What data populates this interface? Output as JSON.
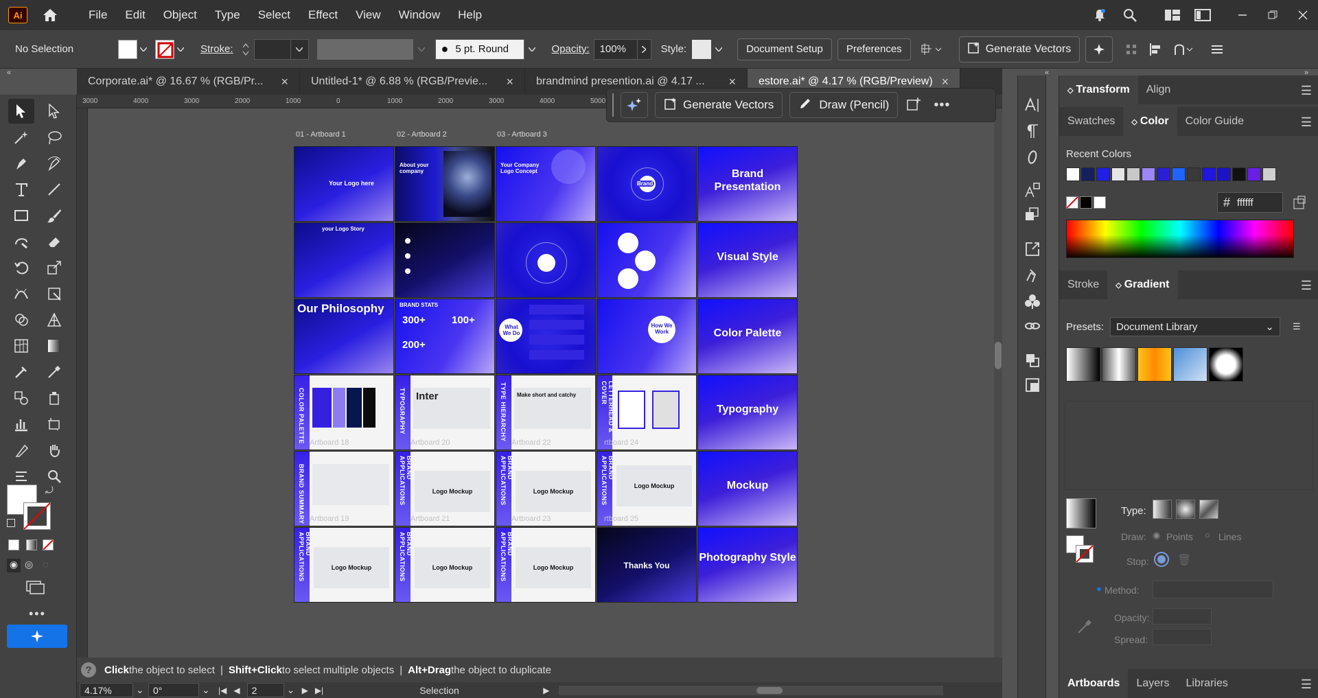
{
  "menu": [
    "File",
    "Edit",
    "Object",
    "Type",
    "Select",
    "Effect",
    "View",
    "Window",
    "Help"
  ],
  "app_logo": "Ai",
  "control": {
    "selection": "No Selection",
    "stroke_label": "Stroke:",
    "brush": "5 pt. Round",
    "opacity_label": "Opacity:",
    "opacity": "100%",
    "style_label": "Style:",
    "document_setup": "Document Setup",
    "preferences": "Preferences",
    "generate_vectors": "Generate Vectors"
  },
  "tabs": [
    {
      "label": "Corporate.ai* @ 16.67 % (RGB/Pr...",
      "active": false
    },
    {
      "label": "Untitled-1* @ 6.88 % (RGB/Previe...",
      "active": false
    },
    {
      "label": "brandmind presention.ai @ 4.17 ...",
      "active": false
    },
    {
      "label": "estore.ai* @ 4.17 % (RGB/Preview)",
      "active": true
    }
  ],
  "ruler_top": [
    "3000",
    "4000",
    "3000",
    "2000",
    "1000",
    "0",
    "1000",
    "2000",
    "3000",
    "4000",
    "5000",
    "6000",
    "7000",
    "8000",
    "9000"
  ],
  "artboard_titles": [
    "01 - Artboard 1",
    "02 - Artboard 2",
    "03 - Artboard 3"
  ],
  "artboards": {
    "your_logo": "Your Logo here",
    "about": "About your company",
    "concept": "Your Company Logo Concept",
    "brand": "Brand",
    "brand_presentation": "Brand Presentation",
    "logo_story": "your Logo Story",
    "visual_style": "Visual Style",
    "philosophy": "Our Philosophy",
    "brand_stats": "BRAND STATS",
    "stat1": "300+",
    "stat2": "100+",
    "stat3": "200+",
    "what_we_do": "What We Do",
    "how_we_work": "How We Work",
    "color_palette": "Color Palette",
    "cp_side": "COLOR PALETTE",
    "typo_side": "TYPOGRAPHY",
    "inter": "Inter",
    "type_hier": "TYPE HIERARCHY",
    "catchy": "Make short and catchy",
    "letterhead": "LETTERHEAD & COVER",
    "typography": "Typography",
    "brand_summary": "BRAND SUMMARY",
    "brand_app": "BRAND APPLICATIONS",
    "logo_mockup": "Logo Mockup",
    "mockup": "Mockup",
    "thanks": "Thanks You",
    "photography": "Photography Style",
    "ab18": "Artboard 18",
    "ab20": "Artboard 20",
    "ab22": "Artboard 22",
    "ab24": "rtboard 24",
    "ab19": "Artboard 19",
    "ab21": "Artboard 21",
    "ab23": "Artboard 23",
    "ab25": "rtboard 25"
  },
  "ctx": {
    "generate": "Generate Vectors",
    "draw": "Draw (Pencil)"
  },
  "hint": {
    "click": "Click",
    "click_t": " the object to select ",
    "shift": "Shift+Click",
    "shift_t": " to select multiple objects ",
    "alt": "Alt+Drag",
    "alt_t": " the object to duplicate"
  },
  "status": {
    "zoom": "4.17%",
    "rotate": "0°",
    "artboard": "2",
    "tool": "Selection"
  },
  "panels": {
    "transform": "Transform",
    "align": "Align",
    "swatches": "Swatches",
    "color": "Color",
    "color_guide": "Color Guide",
    "recent_colors": "Recent Colors",
    "hex": "ffffff",
    "stroke": "Stroke",
    "gradient": "Gradient",
    "presets_label": "Presets:",
    "presets_value": "Document Library",
    "type_label": "Type:",
    "draw_label": "Draw:",
    "points": "Points",
    "lines": "Lines",
    "stop_label": "Stop:",
    "method_label": "Method:",
    "opacity_label": "Opacity:",
    "spread_label": "Spread:",
    "artboards": "Artboards",
    "layers": "Layers",
    "libraries": "Libraries"
  },
  "recent_colors": [
    "#ffffff",
    "#14215c",
    "#1f1fe6",
    "#e6e6e6",
    "#c8c8c8",
    "#9b87f5",
    "#2b1fd6",
    "#1f64ff",
    "#3a3a3a",
    "#2016e0",
    "#1c12c8",
    "#111111",
    "#6a1fe6",
    "#cfcfcf"
  ],
  "accent": "#1473e6"
}
